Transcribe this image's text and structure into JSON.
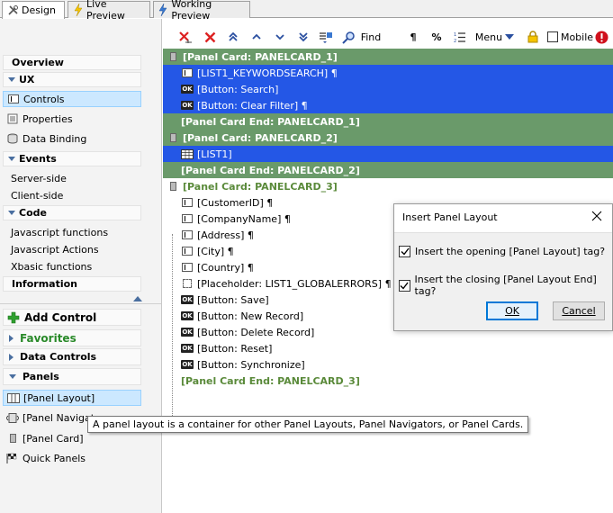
{
  "tabs": [
    {
      "label": "Design",
      "icon": "design-icon"
    },
    {
      "label": "Live Preview",
      "icon": "lightning-icon"
    },
    {
      "label": "Working Preview",
      "icon": "lightning-blue-icon"
    }
  ],
  "left": {
    "overview": "Overview",
    "ux": "UX",
    "ux_items": [
      "Controls",
      "Properties",
      "Data Binding"
    ],
    "events": "Events",
    "events_items": [
      "Server-side",
      "Client-side"
    ],
    "code": "Code",
    "code_items": [
      "Javascript functions",
      "Javascript Actions",
      "Xbasic functions"
    ],
    "information": "Information",
    "add_control": "Add Control",
    "favorites": "Favorites",
    "data_controls": "Data Controls",
    "panels": "Panels",
    "panel_items": [
      "[Panel Layout]",
      "[Panel Navigato",
      "[Panel Card]",
      "Quick Panels"
    ]
  },
  "tooltip": "A panel layout is a container for other Panel Layouts, Panel Navigators, or Panel Cards.",
  "toolbar": {
    "find": "Find",
    "pilcrow": "¶",
    "percent": "%",
    "menu": "Menu",
    "mobile": "Mobile"
  },
  "tree": {
    "rows": [
      {
        "text": "[Panel Card: PANELCARD_1]",
        "style": "green",
        "icon": "panel"
      },
      {
        "text": "[LIST1_KEYWORDSEARCH] ¶",
        "style": "blue",
        "icon": "field"
      },
      {
        "text": "[Button: Search]",
        "style": "blue",
        "icon": "ok"
      },
      {
        "text": "[Button: Clear Filter] ¶",
        "style": "blue",
        "icon": "ok"
      },
      {
        "text": "[Panel Card End: PANELCARD_1]",
        "style": "green",
        "icon": "none"
      },
      {
        "text": "[Panel Card: PANELCARD_2]",
        "style": "green",
        "icon": "panel"
      },
      {
        "text": "[LIST1]",
        "style": "blue",
        "icon": "list"
      },
      {
        "text": "[Panel Card End: PANELCARD_2]",
        "style": "green",
        "icon": "none"
      },
      {
        "text": "[Panel Card: PANELCARD_3]",
        "style": "plain-green",
        "icon": "panel"
      },
      {
        "text": "[CustomerID] ¶",
        "style": "plain",
        "icon": "field"
      },
      {
        "text": "[CompanyName] ¶",
        "style": "plain",
        "icon": "field"
      },
      {
        "text": "[Address] ¶",
        "style": "plain",
        "icon": "field"
      },
      {
        "text": "[City] ¶",
        "style": "plain",
        "icon": "field"
      },
      {
        "text": "[Country] ¶",
        "style": "plain",
        "icon": "field"
      },
      {
        "text": "[Placeholder: LIST1_GLOBALERRORS] ¶",
        "style": "plain",
        "icon": "placeholder"
      },
      {
        "text": "[Button: Save]",
        "style": "plain",
        "icon": "ok"
      },
      {
        "text": "[Button: New Record]",
        "style": "plain",
        "icon": "ok"
      },
      {
        "text": "[Button: Delete Record]",
        "style": "plain",
        "icon": "ok"
      },
      {
        "text": "[Button: Reset]",
        "style": "plain",
        "icon": "ok"
      },
      {
        "text": "[Button: Synchronize]",
        "style": "plain",
        "icon": "ok"
      },
      {
        "text": "[Panel Card End: PANELCARD_3]",
        "style": "plain-green",
        "icon": "none"
      }
    ]
  },
  "dialog": {
    "title": "Insert Panel Layout",
    "opt1": "Insert the opening [Panel Layout] tag?",
    "opt2": "Insert the closing [Panel Layout End] tag?",
    "ok": "OK",
    "cancel": "Cancel"
  },
  "colors": {
    "selection_blue": "#2457e6",
    "panel_green": "#6a9a6a",
    "green_text": "#5a8a3a",
    "left_selected": "#cce8ff"
  }
}
